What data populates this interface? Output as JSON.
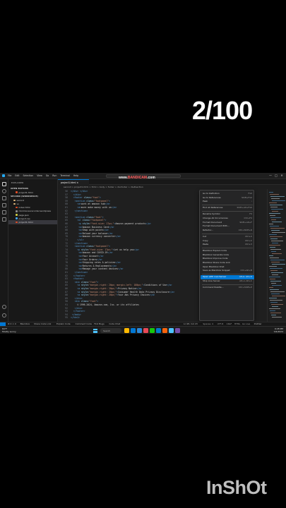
{
  "overlay": {
    "counter": "2/100",
    "watermark": "InShOt",
    "recorder": {
      "brand_prefix": "www.",
      "brand_main": "BANDICAM",
      "brand_suffix": ".com"
    }
  },
  "titlebar": {
    "menu": [
      "File",
      "Edit",
      "Selection",
      "View",
      "Go",
      "Run",
      "Terminal",
      "Help"
    ],
    "window_controls": [
      "—",
      "□",
      "✕"
    ]
  },
  "sidebar": {
    "title": "EXPLORER",
    "open_editors_label": "OPEN EDITORS",
    "open_editors": [
      {
        "name": "project1.html",
        "color": "#e44d26"
      }
    ],
    "workspace_label": "SECOND (WORKSPACE)",
    "tree": [
      {
        "name": "second",
        "color": "#dcb67a",
        "folder": true
      },
      {
        "name": "vs",
        "color": "#dcb67a",
        "folder": true
      },
      {
        "name": "index.html",
        "color": "#e44d26"
      },
      {
        "name": "minimal-avrecorder.wordpress",
        "color": "#8a8a8a"
      },
      {
        "name": "page.json",
        "color": "#cbcb41"
      },
      {
        "name": "project.css",
        "color": "#42a5f5"
      },
      {
        "name": "project1.html",
        "color": "#e44d26",
        "selected": true
      }
    ]
  },
  "tab": {
    "label": "project1.html ×"
  },
  "breadcrumb": "second > project1.html > html > body > footer > div.footer > div#section",
  "code": [
    {
      "n": "56",
      "h": "<span class='c-tag'>&lt;/div&gt;</span> <span class='c-tag'>&lt;/div&gt;</span>"
    },
    {
      "n": "57",
      "h": "  <span class='c-tag'>&lt;/div&gt;</span>"
    },
    {
      "n": "58",
      "h": "  <span class='c-tag'>&lt;footer</span> <span class='c-attr'>class</span>=<span class='c-str'>\"foot\"</span><span class='c-tag'>&gt;</span>"
    },
    {
      "n": "59",
      "h": "   <span class='c-tag'>&lt;section</span> <span class='c-attr'>class</span>=<span class='c-str'>\"footpanel\"</span><span class='c-tag'>&gt;</span>"
    },
    {
      "n": "60",
      "h": "     <span class='c-tag'>&lt;a&gt;</span><span class='c-txt'>work at amazon hub</span><span class='c-tag'>&lt;/a&gt;</span>"
    },
    {
      "n": "61",
      "h": "     <span class='c-tag'>&lt;a&gt;</span><span class='c-txt'>more make money with us</span><span class='c-tag'>&lt;/a&gt;</span>"
    },
    {
      "n": "62",
      "h": "   <span class='c-tag'>&lt;/section&gt;</span>"
    },
    {
      "n": "63",
      "h": ""
    },
    {
      "n": "64",
      "h": "   <span class='c-tag'>&lt;section</span> <span class='c-attr'>class</span>=<span class='c-str'>\"foot\"</span><span class='c-tag'>&gt;</span>"
    },
    {
      "n": "65",
      "h": "     <span class='c-tag'>&lt;ul</span> <span class='c-attr'>class</span>=<span class='c-str'>\"footpanel\"</span><span class='c-tag'>&gt;</span>"
    },
    {
      "n": "66",
      "h": "      <span class='c-tag'>&lt;p</span> <span class='c-attr'>style</span>=<span class='c-str'>\"font-size: 17px;\"</span><span class='c-tag'>&gt;</span><span class='c-txt'>Amazon payment products</span><span class='c-tag'>&lt;/p&gt;</span>"
    },
    {
      "n": "67",
      "h": "      <span class='c-tag'>&lt;a&gt;</span><span class='c-txt'>Amazon Business Card</span><span class='c-tag'>&lt;/a&gt;</span>"
    },
    {
      "n": "68",
      "h": "      <span class='c-tag'>&lt;a&gt;</span><span class='c-txt'>Shop with points</span><span class='c-tag'>&lt;/a&gt;</span>"
    },
    {
      "n": "69",
      "h": "      <span class='c-tag'>&lt;a&gt;</span><span class='c-txt'>Reload your balance</span><span class='c-tag'>&lt;/a&gt;</span>"
    },
    {
      "n": "70",
      "h": "      <span class='c-tag'>&lt;a&gt;</span><span class='c-txt'>Amazon currency converter</span><span class='c-tag'>&lt;/a&gt;</span>"
    },
    {
      "n": "71",
      "h": "     <span class='c-tag'>&lt;/ul&gt;</span>"
    },
    {
      "n": "72",
      "h": "   <span class='c-tag'>&lt;/section&gt;</span>"
    },
    {
      "n": "73",
      "h": "   <span class='c-tag'>&lt;section</span> <span class='c-attr'>class</span>=<span class='c-str'>\"footpanel\"</span><span class='c-tag'>&gt;</span>"
    },
    {
      "n": "74",
      "h": "     <span class='c-tag'>&lt;p</span> <span class='c-attr'>style</span>=<span class='c-str'>\"font-size: 17px;\"</span><span class='c-tag'>&gt;</span><span class='c-txt'>Let us help you</span><span class='c-tag'>&lt;/p&gt;</span>"
    },
    {
      "n": "75",
      "h": "      <span class='c-tag'>&lt;a&gt;</span><span class='c-txt'>Amazon and COVID-19</span><span class='c-tag'>&lt;/a&gt;</span>"
    },
    {
      "n": "76",
      "h": "      <span class='c-tag'>&lt;a&gt;</span><span class='c-txt'>Your Account</span><span class='c-tag'>&lt;/a&gt;</span>"
    },
    {
      "n": "77",
      "h": "      <span class='c-tag'>&lt;a&gt;</span><span class='c-txt'>Your Orders</span><span class='c-tag'>&lt;/a&gt;</span>"
    },
    {
      "n": "78",
      "h": "      <span class='c-tag'>&lt;a&gt;</span><span class='c-txt'>Shipping rates &amp; policies</span><span class='c-tag'>&lt;/a&gt;</span>"
    },
    {
      "n": "79",
      "h": "      <span class='c-tag'>&lt;a&gt;</span><span class='c-txt'>Returns &amp; Replacements</span><span class='c-tag'>&lt;/a&gt;</span>"
    },
    {
      "n": "80",
      "h": "      <span class='c-tag'>&lt;a&gt;</span><span class='c-txt'>Manage your content devices</span><span class='c-tag'>&lt;/a&gt;</span>"
    },
    {
      "n": "81",
      "h": "   <span class='c-tag'>&lt;/section&gt;</span>"
    },
    {
      "n": "82",
      "h": "  <span class='c-tag'>&lt;/footer&gt;</span>"
    },
    {
      "n": "83",
      "h": "  <span class='c-tag'>&lt;footer&gt;</span>"
    },
    {
      "n": "84",
      "h": "   <span class='c-tag'>&lt;div</span> <span class='c-attr'>class</span>=<span class='c-str'>\"foot\"</span><span class='c-tag'>&gt;</span>"
    },
    {
      "n": "85",
      "h": "     <span class='c-tag'>&lt;a</span> <span class='c-attr'>style</span>=<span class='c-str'>\"margin-right: 20px; margin-left: 180px;\"</span><span class='c-tag'>&gt;</span><span class='c-txt'>Conditions of Use</span><span class='c-tag'>&lt;/a&gt;</span>"
    },
    {
      "n": "86",
      "h": "     <span class='c-tag'>&lt;a</span> <span class='c-attr'>style</span>=<span class='c-str'>\"margin-right: 20px;\"</span><span class='c-tag'>&gt;</span><span class='c-txt'>Privacy Notice</span><span class='c-tag'>&lt;/a&gt;</span>"
    },
    {
      "n": "87",
      "h": "     <span class='c-tag'>&lt;a</span> <span class='c-attr'>style</span>=<span class='c-str'>\"margin-right: 20px;\"</span><span class='c-tag'>&gt;</span><span class='c-txt'>Consumer Health Data Privacy Disclosure</span><span class='c-tag'>&lt;/a&gt;</span>"
    },
    {
      "n": "88",
      "h": "     <span class='c-tag'>&lt;a</span> <span class='c-attr'>style</span>=<span class='c-str'>\"margin-right: 20px;\"</span><span class='c-tag'>&gt;</span><span class='c-txt'>Your Ads Privacy Choices</span><span class='c-tag'>&lt;/a&gt;</span>"
    },
    {
      "n": "89",
      "h": "   <span class='c-tag'>&lt;/div&gt;</span>"
    },
    {
      "n": "90",
      "h": "   <span class='c-tag'>&lt;div</span> <span class='c-attr'>class</span>=<span class='c-str'>\"foot\"</span><span class='c-tag'>&gt;</span>"
    },
    {
      "n": "91",
      "h": "     <span class='c-txt'>© 1996-2024, Amazon.com, Inc. or its affiliates</span>"
    },
    {
      "n": "92",
      "h": "   <span class='c-tag'>&lt;/div&gt;</span>"
    },
    {
      "n": "93",
      "h": "  <span class='c-tag'>&lt;/footer&gt;</span>"
    },
    {
      "n": "94",
      "h": " <span class='c-tag'>&lt;/body&gt;</span>"
    },
    {
      "n": "95",
      "h": "<span class='c-tag'>&lt;/html&gt;</span>"
    }
  ],
  "context_menu": [
    {
      "label": "Go to Definition",
      "sc": "F12"
    },
    {
      "label": "Go to References",
      "sc": "Shift+F12"
    },
    {
      "label": "Peek",
      "sc": "›"
    },
    {
      "sep": true
    },
    {
      "label": "Find All References",
      "sc": "Shift+Alt+F12"
    },
    {
      "sep": true
    },
    {
      "label": "Rename Symbol",
      "sc": "F2"
    },
    {
      "label": "Change All Occurrences",
      "sc": "Ctrl+F2"
    },
    {
      "label": "Format Document",
      "sc": "Shift+Alt+F"
    },
    {
      "label": "Format Document With...",
      "sc": ""
    },
    {
      "label": "Refactor...",
      "sc": "Ctrl+Shift+R"
    },
    {
      "sep": true
    },
    {
      "label": "Cut",
      "sc": "Ctrl+X"
    },
    {
      "label": "Copy",
      "sc": "Ctrl+C"
    },
    {
      "label": "Paste",
      "sc": "Ctrl+V"
    },
    {
      "sep": true
    },
    {
      "label": "Blackbox Explain Code",
      "sc": ""
    },
    {
      "label": "Blackbox Generate Code",
      "sc": ""
    },
    {
      "label": "Blackbox Improve Code",
      "sc": ""
    },
    {
      "label": "Blackbox Share Code Link",
      "sc": ""
    },
    {
      "label": "Open Blackbox Chat",
      "sc": ""
    },
    {
      "label": "Save as Blackbox Snippet",
      "sc": "Ctrl+Alt+B"
    },
    {
      "sep": true
    },
    {
      "label": "Open with Live Server",
      "sc": "Alt+L Alt+O",
      "hl": true
    },
    {
      "label": "Stop Live Server",
      "sc": "Alt+L Alt+C"
    },
    {
      "sep": true
    },
    {
      "label": "Command Palette...",
      "sc": "Ctrl+Shift+P"
    }
  ],
  "statusbar": {
    "left": [
      "⊗ 0 ⚠ 0",
      "Blackbox",
      "Share Code Link",
      "Explain Code",
      "Comment Code",
      "Find Bugs",
      "Code Chat"
    ],
    "right": [
      "Ln 95, Col 23",
      "Spaces: 4",
      "UTF-8",
      "CRLF",
      "HTML",
      "Go Live",
      "Prettier"
    ]
  },
  "taskbar": {
    "weather_temp": "84°F",
    "weather_desc": "Mostly sunny",
    "search_label": "Search",
    "clock_time": "9:28 PM",
    "clock_date": "7/6/2024",
    "app_colors": [
      "#ffb900",
      "#0078d4",
      "#2b88d8",
      "#e74856",
      "#16c60c",
      "#007acc",
      "#f7630c",
      "#4cc2ff",
      "#744da9"
    ]
  }
}
